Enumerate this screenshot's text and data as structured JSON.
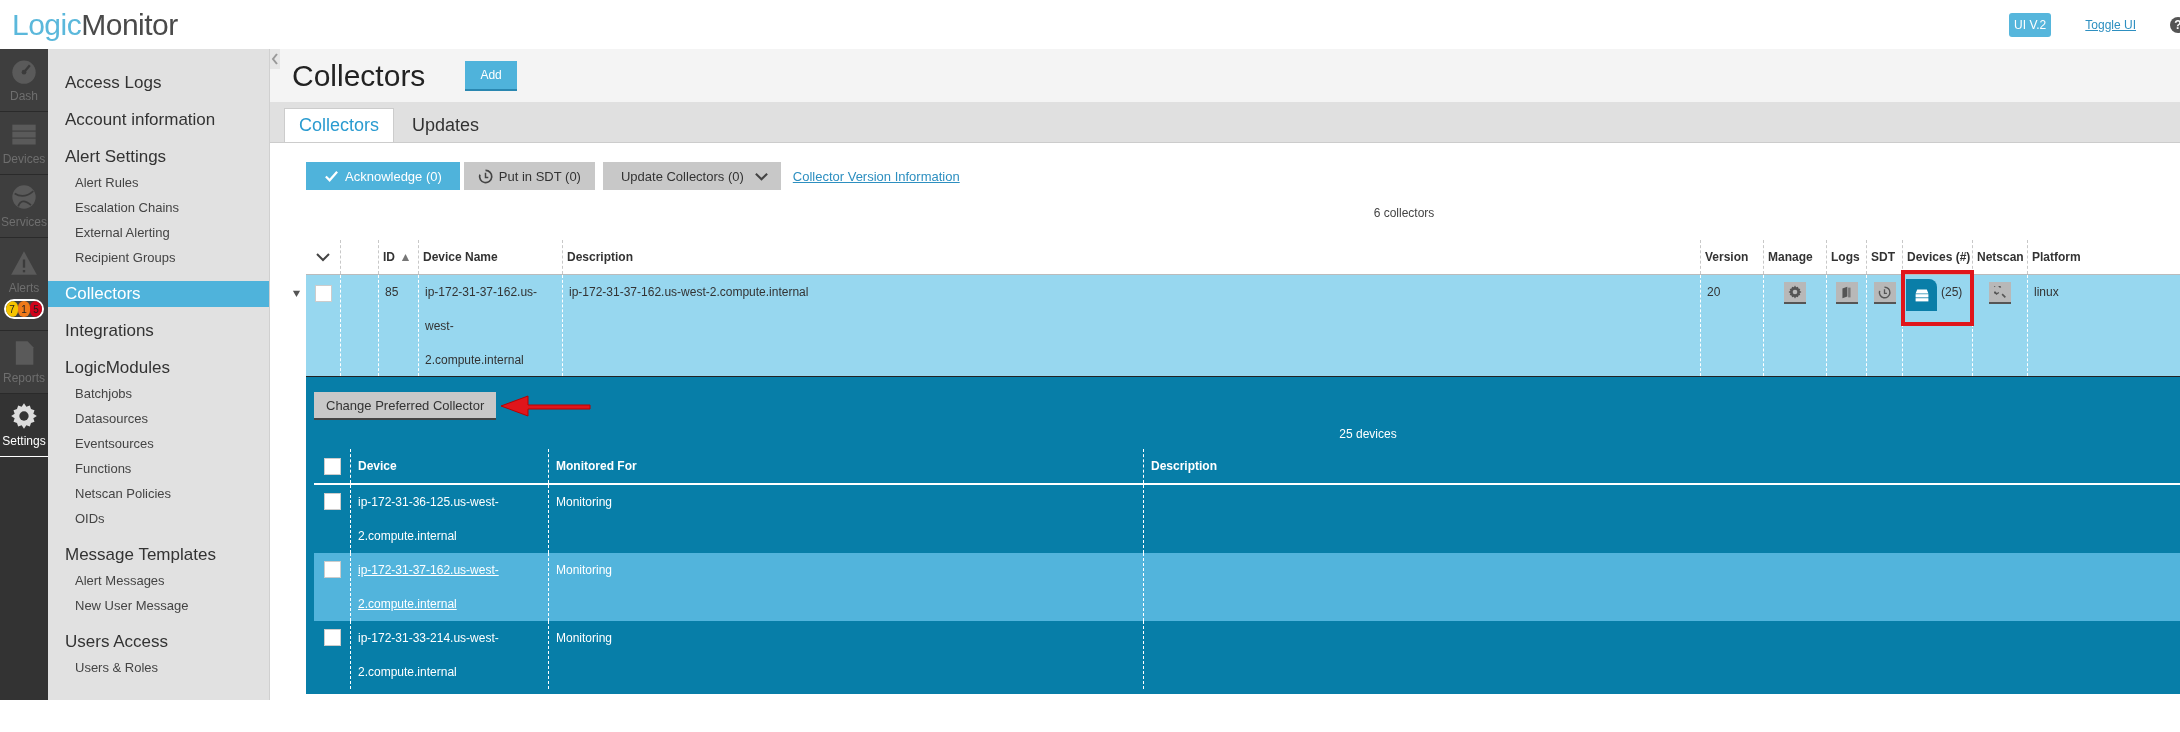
{
  "header": {
    "logo": [
      "Logic",
      "Monitor"
    ],
    "version_badge": "UI V.2",
    "toggle_link": "Toggle UI",
    "help": "?"
  },
  "nav": [
    {
      "kind": "gauge",
      "label": "Dash",
      "selected": false
    },
    {
      "kind": "server",
      "label": "Devices",
      "selected": false
    },
    {
      "kind": "globe",
      "label": "Services",
      "selected": false
    },
    {
      "kind": "alert",
      "label": "Alerts",
      "selected": false,
      "badges": [
        {
          "count": "7",
          "color": "#f5c400"
        },
        {
          "count": "1",
          "color": "#f07a1a"
        },
        {
          "count": "5",
          "color": "#d0021b"
        }
      ]
    },
    {
      "kind": "report",
      "label": "Reports",
      "selected": false
    },
    {
      "kind": "gear",
      "label": "Settings",
      "selected": true
    }
  ],
  "sidebar": {
    "items": [
      {
        "kind": "heading",
        "label": "Access Logs",
        "selected": false
      },
      {
        "kind": "heading",
        "label": "Account information",
        "selected": false
      },
      {
        "kind": "heading",
        "label": "Alert Settings",
        "selected": false
      },
      {
        "kind": "sub",
        "label": "Alert Rules",
        "selected": false
      },
      {
        "kind": "sub",
        "label": "Escalation Chains",
        "selected": false
      },
      {
        "kind": "sub",
        "label": "External Alerting",
        "selected": false
      },
      {
        "kind": "sub",
        "label": "Recipient Groups",
        "selected": false
      },
      {
        "kind": "heading",
        "label": "Collectors",
        "selected": true
      },
      {
        "kind": "heading",
        "label": "Integrations",
        "selected": false
      },
      {
        "kind": "heading",
        "label": "LogicModules",
        "selected": false
      },
      {
        "kind": "sub",
        "label": "Batchjobs",
        "selected": false
      },
      {
        "kind": "sub",
        "label": "Datasources",
        "selected": false
      },
      {
        "kind": "sub",
        "label": "Eventsources",
        "selected": false
      },
      {
        "kind": "sub",
        "label": "Functions",
        "selected": false
      },
      {
        "kind": "sub",
        "label": "Netscan Policies",
        "selected": false
      },
      {
        "kind": "sub",
        "label": "OIDs",
        "selected": false
      },
      {
        "kind": "heading",
        "label": "Message Templates",
        "selected": false
      },
      {
        "kind": "sub",
        "label": "Alert Messages",
        "selected": false
      },
      {
        "kind": "sub",
        "label": "New User Message",
        "selected": false
      },
      {
        "kind": "heading",
        "label": "Users Access",
        "selected": false
      },
      {
        "kind": "sub",
        "label": "Users & Roles",
        "selected": false
      }
    ]
  },
  "page": {
    "title": "Collectors",
    "add_button": "Add"
  },
  "tabs": [
    {
      "label": "Collectors",
      "selected": true
    },
    {
      "label": "Updates",
      "selected": false
    }
  ],
  "toolbar": {
    "buttons": [
      {
        "kind": "acknowledge",
        "label": "Acknowledge (0)"
      },
      {
        "kind": "sdt",
        "label": "Put in SDT (0)"
      },
      {
        "kind": "dropdown",
        "label": "Update Collectors (0)"
      }
    ],
    "link": "Collector Version Information"
  },
  "collector_count": "6 collectors",
  "collectors_table": {
    "columns": [
      {
        "label": "ID",
        "sorted": true
      },
      {
        "label": "Device Name",
        "sorted": false
      },
      {
        "label": "Description",
        "sorted": false
      },
      {
        "label": "Version",
        "sorted": false
      },
      {
        "label": "Manage",
        "sorted": false
      },
      {
        "label": "Logs",
        "sorted": false
      },
      {
        "label": "SDT",
        "sorted": false
      },
      {
        "label": "Devices (#)",
        "sorted": false
      },
      {
        "label": "Netscan",
        "sorted": false
      },
      {
        "label": "Platform",
        "sorted": false
      }
    ],
    "rows": [
      {
        "expanded": true,
        "checked": false,
        "id": "85",
        "device_name": "ip-172-31-37-162.us-west-2.compute.internal",
        "description": "ip-172-31-37-162.us-west-2.compute.internal",
        "version": "20",
        "devices_count": "(25)",
        "platform": "linux"
      }
    ]
  },
  "devices_panel": {
    "button": "Change Preferred Collector",
    "count": "25 devices",
    "columns": [
      "Device",
      "Monitored For",
      "Description"
    ],
    "all_checked": false,
    "rows": [
      {
        "device": "ip-172-31-36-125.us-west-2.compute.internal",
        "monitored_for": "Monitoring",
        "checked": false,
        "selected": false
      },
      {
        "device": "ip-172-31-37-162.us-west-2.compute.internal",
        "monitored_for": "Monitoring",
        "checked": false,
        "selected": true
      },
      {
        "device": "ip-172-31-33-214.us-west-2.compute.internal",
        "monitored_for": "Monitoring",
        "checked": false,
        "selected": false
      }
    ]
  }
}
